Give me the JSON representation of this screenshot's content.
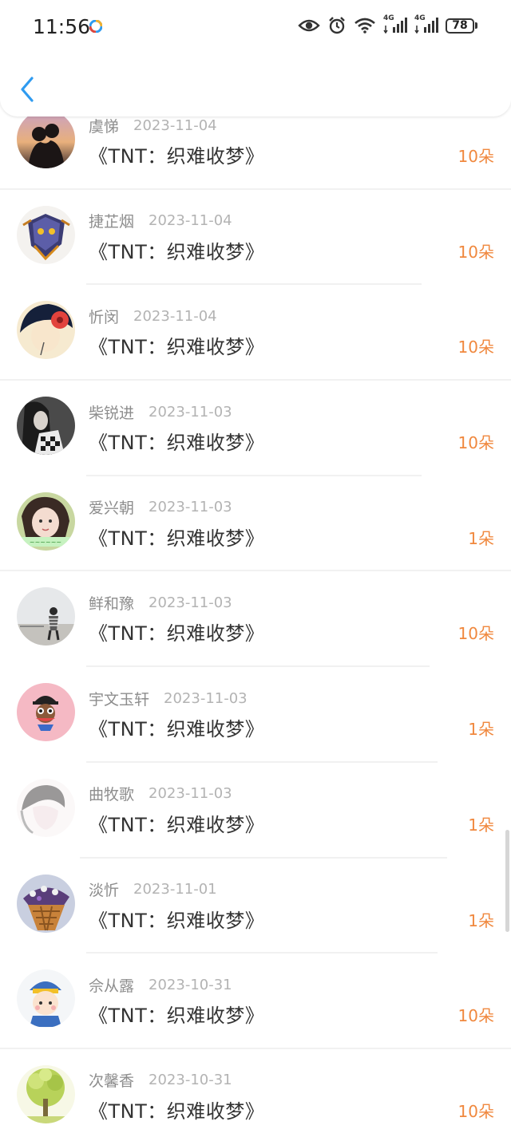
{
  "status_bar": {
    "time": "11:56",
    "network1": "4G",
    "network2": "4G",
    "battery": "78",
    "icons": [
      "eye-icon",
      "alarm-icon",
      "wifi-icon",
      "signal-icon",
      "signal-icon",
      "battery-icon"
    ]
  },
  "header": {
    "back_icon": "chevron-left-icon",
    "accent": "#2f9bf0"
  },
  "colors": {
    "count": "#f0883e",
    "name": "#8d8d8d",
    "date": "#b3b3b3",
    "title": "#333333"
  },
  "records": [
    {
      "name": "虞悌",
      "date": "2023-11-04",
      "title": "《TNT：织难收梦》",
      "count": "10朵"
    },
    {
      "name": "捷芷烟",
      "date": "2023-11-04",
      "title": "《TNT：织难收梦》",
      "count": "10朵"
    },
    {
      "name": "忻闵",
      "date": "2023-11-04",
      "title": "《TNT：织难收梦》",
      "count": "10朵"
    },
    {
      "name": "柴锐进",
      "date": "2023-11-03",
      "title": "《TNT：织难收梦》",
      "count": "10朵"
    },
    {
      "name": "爱兴朝",
      "date": "2023-11-03",
      "title": "《TNT：织难收梦》",
      "count": "1朵"
    },
    {
      "name": "鲜和豫",
      "date": "2023-11-03",
      "title": "《TNT：织难收梦》",
      "count": "10朵"
    },
    {
      "name": "宇文玉轩",
      "date": "2023-11-03",
      "title": "《TNT：织难收梦》",
      "count": "1朵"
    },
    {
      "name": "曲牧歌",
      "date": "2023-11-03",
      "title": "《TNT：织难收梦》",
      "count": "1朵"
    },
    {
      "name": "淡忻",
      "date": "2023-11-01",
      "title": "《TNT：织难收梦》",
      "count": "1朵"
    },
    {
      "name": "佘从露",
      "date": "2023-10-31",
      "title": "《TNT：织难收梦》",
      "count": "10朵"
    },
    {
      "name": "次馨香",
      "date": "2023-10-31",
      "title": "《TNT：织难收梦》",
      "count": "10朵"
    }
  ]
}
